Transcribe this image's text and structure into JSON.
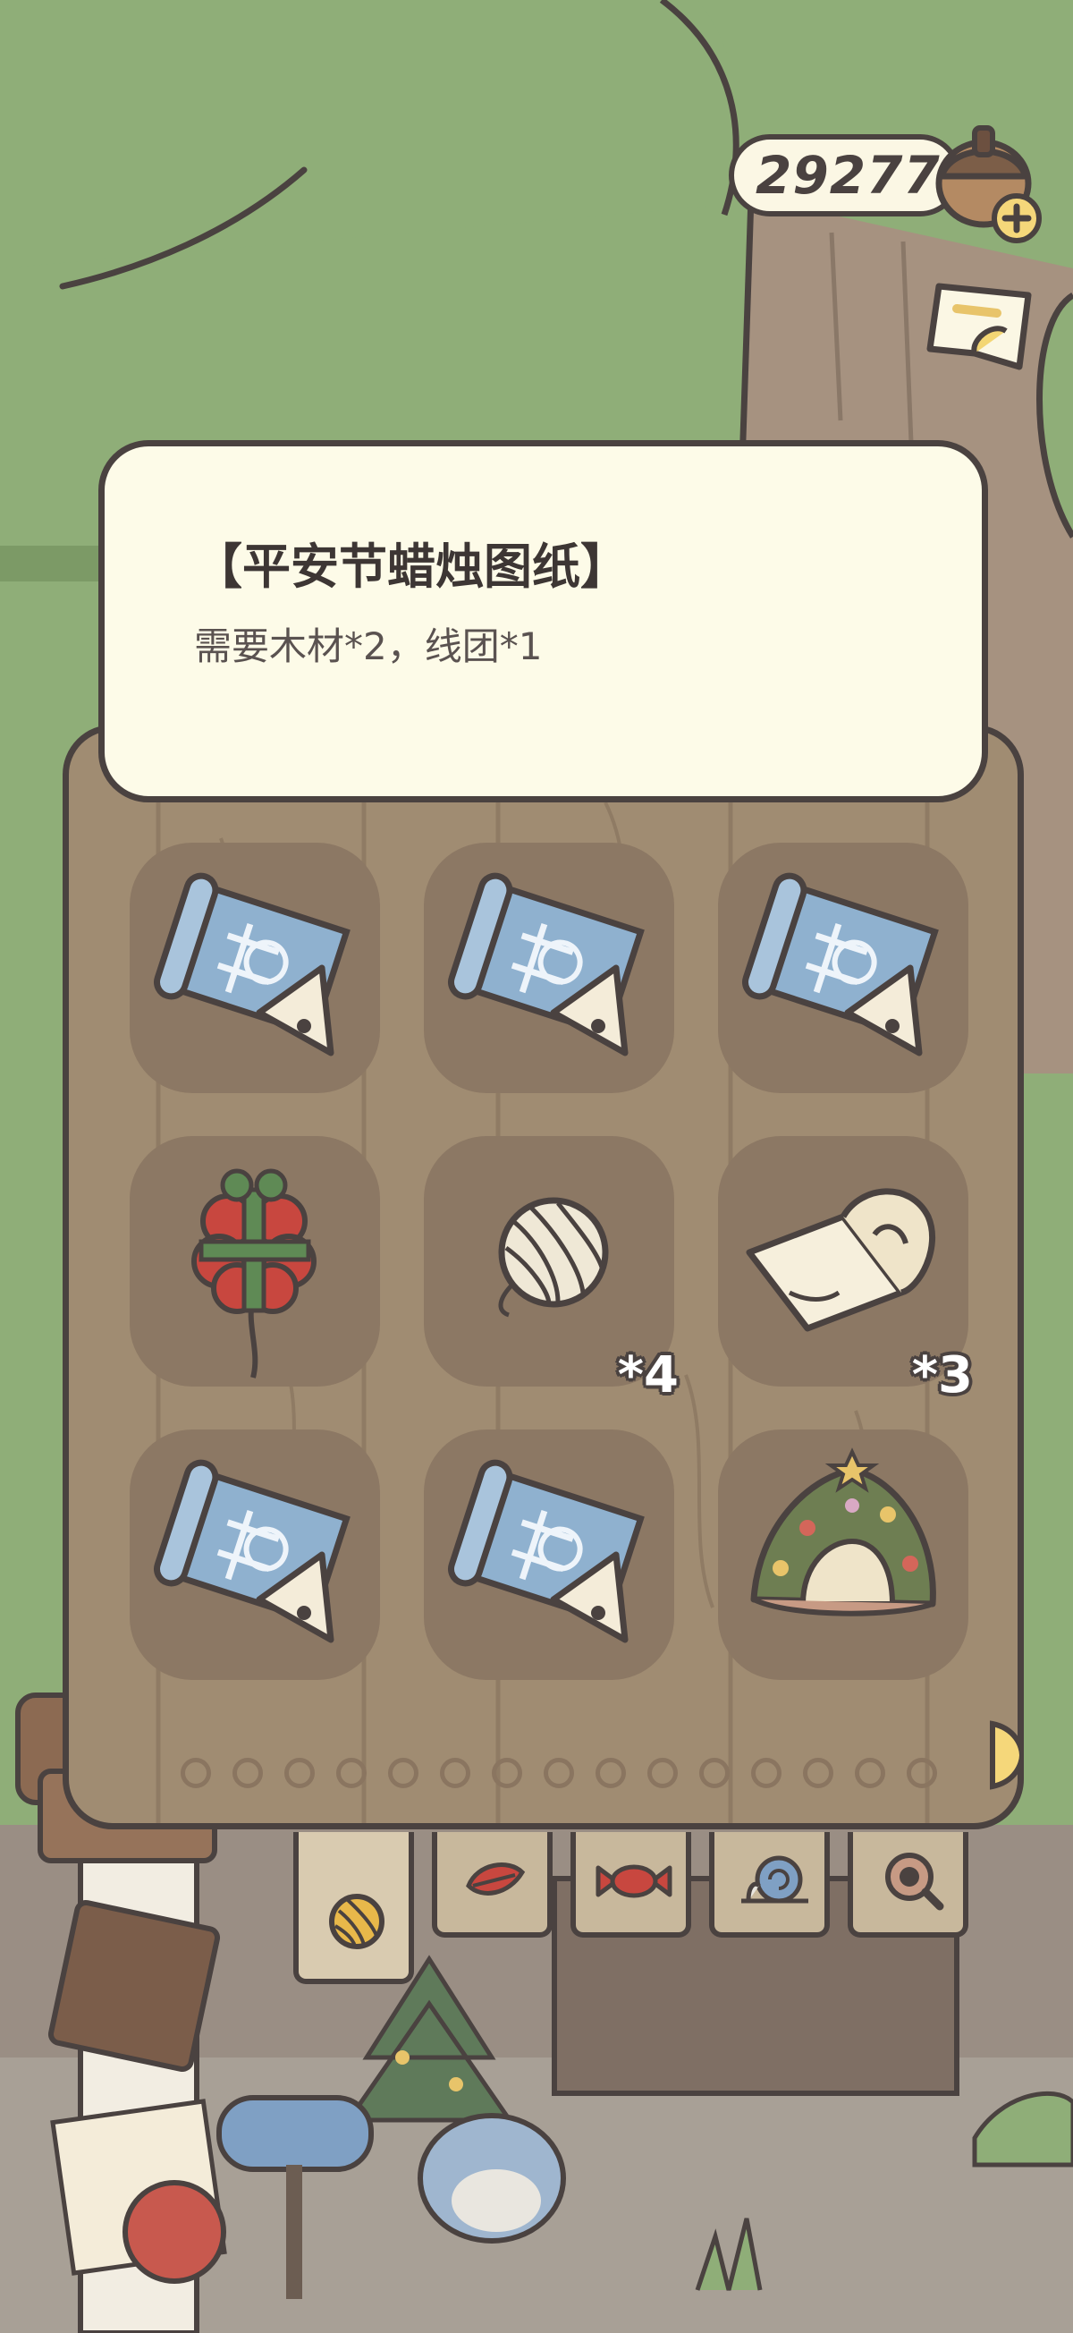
{
  "currency": {
    "amount": "292774",
    "icon": "acorn-icon",
    "add_icon": "plus-icon"
  },
  "tooltip": {
    "title": "【平安节蜡烛图纸】",
    "description": "需要木材*2，线团*1"
  },
  "inventory": {
    "slots": [
      {
        "item": "blueprint-icon",
        "count": ""
      },
      {
        "item": "blueprint-icon",
        "count": ""
      },
      {
        "item": "blueprint-icon",
        "count": ""
      },
      {
        "item": "gift-balloon-icon",
        "count": ""
      },
      {
        "item": "yarn-ball-icon",
        "count": "*4"
      },
      {
        "item": "paper-scroll-icon",
        "count": "*3"
      },
      {
        "item": "blueprint-icon",
        "count": ""
      },
      {
        "item": "blueprint-icon",
        "count": ""
      },
      {
        "item": "festive-tent-icon",
        "count": ""
      }
    ],
    "page_count": 15,
    "current_page": 1
  },
  "tabs": [
    {
      "name": "yarn-tab",
      "icon": "yarn-icon",
      "active": true
    },
    {
      "name": "leaf-tab",
      "icon": "leaf-icon",
      "active": false
    },
    {
      "name": "candy-tab",
      "icon": "candy-icon",
      "active": false
    },
    {
      "name": "snail-tab",
      "icon": "snail-icon",
      "active": false
    },
    {
      "name": "magnifier-tab",
      "icon": "magnifier-icon",
      "active": false
    }
  ],
  "colors": {
    "outline": "#4a4240",
    "board": "#a08c72",
    "slot": "#8c7864",
    "tooltip_bg": "#fdfbe8",
    "grass": "#8fae78"
  }
}
